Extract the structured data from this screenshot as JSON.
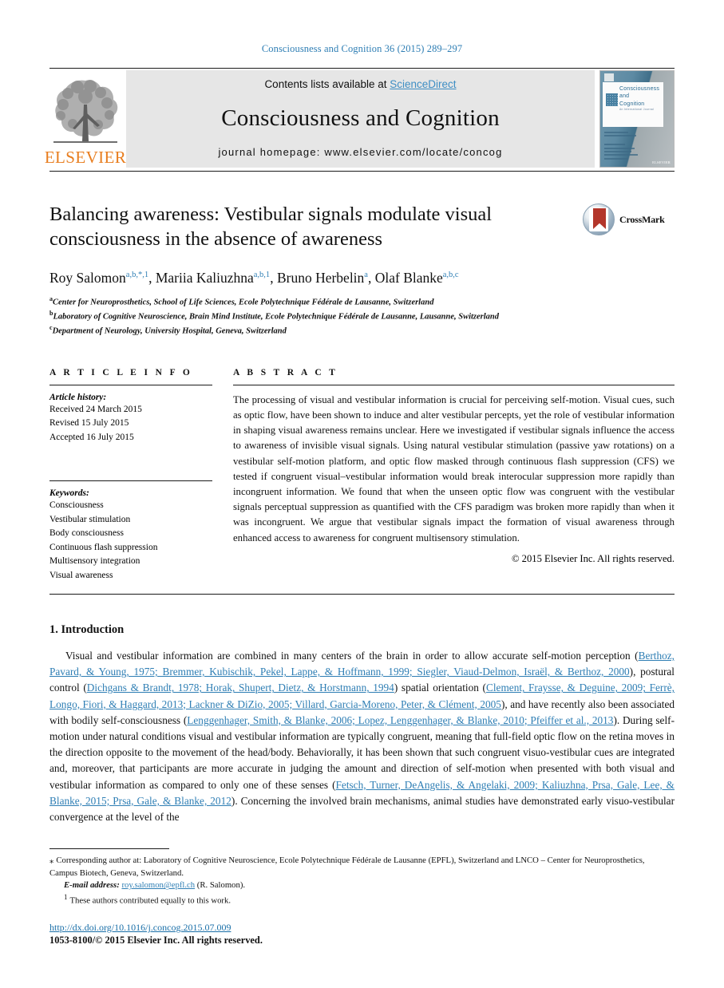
{
  "running_head": "Consciousness and Cognition 36 (2015) 289–297",
  "masthead": {
    "contents_prefix": "Contents lists available at ",
    "sciencedirect": "ScienceDirect",
    "journal_name": "Consciousness and Cognition",
    "homepage": "journal homepage: www.elsevier.com/locate/concog",
    "publisher": "ELSEVIER",
    "cover": {
      "title_line1": "Consciousness",
      "title_line2": "and",
      "title_line3": "Cognition",
      "subtitle": "An International Journal",
      "publisher_mark": "ELSEVIER"
    },
    "colors": {
      "link_blue": "#3e8ec4",
      "elsevier_orange": "#e87d1e",
      "panel_grey": "#e6e6e6"
    }
  },
  "article": {
    "title": "Balancing awareness: Vestibular signals modulate visual consciousness in the absence of awareness",
    "crossmark_label": "CrossMark",
    "authors": [
      {
        "name": "Roy Salomon",
        "sup": "a,b,*,1"
      },
      {
        "name": "Mariia Kaliuzhna",
        "sup": "a,b,1"
      },
      {
        "name": "Bruno Herbelin",
        "sup": "a"
      },
      {
        "name": "Olaf Blanke",
        "sup": "a,b,c"
      }
    ],
    "affiliations": [
      {
        "marker": "a",
        "text": "Center for Neuroprosthetics, School of Life Sciences, Ecole Polytechnique Fédérale de Lausanne, Switzerland"
      },
      {
        "marker": "b",
        "text": "Laboratory of Cognitive Neuroscience, Brain Mind Institute, Ecole Polytechnique Fédérale de Lausanne, Lausanne, Switzerland"
      },
      {
        "marker": "c",
        "text": "Department of Neurology, University Hospital, Geneva, Switzerland"
      }
    ]
  },
  "article_info": {
    "heading": "A R T I C L E   I N F O",
    "history_label": "Article history:",
    "history": [
      "Received 24 March 2015",
      "Revised 15 July 2015",
      "Accepted 16 July 2015"
    ],
    "keywords_label": "Keywords:",
    "keywords": [
      "Consciousness",
      "Vestibular stimulation",
      "Body consciousness",
      "Continuous flash suppression",
      "Multisensory integration",
      "Visual awareness"
    ]
  },
  "abstract": {
    "heading": "A B S T R A C T",
    "text": "The processing of visual and vestibular information is crucial for perceiving self-motion. Visual cues, such as optic flow, have been shown to induce and alter vestibular percepts, yet the role of vestibular information in shaping visual awareness remains unclear. Here we investigated if vestibular signals influence the access to awareness of invisible visual signals. Using natural vestibular stimulation (passive yaw rotations) on a vestibular self-motion platform, and optic flow masked through continuous flash suppression (CFS) we tested if congruent visual–vestibular information would break interocular suppression more rapidly than incongruent information. We found that when the unseen optic flow was congruent with the vestibular signals perceptual suppression as quantified with the CFS paradigm was broken more rapidly than when it was incongruent. We argue that vestibular signals impact the formation of visual awareness through enhanced access to awareness for congruent multisensory stimulation.",
    "copyright": "© 2015 Elsevier Inc. All rights reserved."
  },
  "introduction": {
    "heading": "1. Introduction",
    "paragraph_parts": [
      {
        "type": "text",
        "value": "Visual and vestibular information are combined in many centers of the brain in order to allow accurate self-motion perception ("
      },
      {
        "type": "ref",
        "value": "Berthoz, Pavard, & Young, 1975; Bremmer, Kubischik, Pekel, Lappe, & Hoffmann, 1999; Siegler, Viaud-Delmon, Israël, & Berthoz, 2000"
      },
      {
        "type": "text",
        "value": "), postural control ("
      },
      {
        "type": "ref",
        "value": "Dichgans & Brandt, 1978; Horak, Shupert, Dietz, & Horstmann, 1994"
      },
      {
        "type": "text",
        "value": ") spatial orientation ("
      },
      {
        "type": "ref",
        "value": "Clement, Fraysse, & Deguine, 2009; Ferrè, Longo, Fiori, & Haggard, 2013; Lackner & DiZio, 2005; Villard, Garcia-Moreno, Peter, & Clément, 2005"
      },
      {
        "type": "text",
        "value": "), and have recently also been associated with bodily self-consciousness ("
      },
      {
        "type": "ref",
        "value": "Lenggenhager, Smith, & Blanke, 2006; Lopez, Lenggenhager, & Blanke, 2010; Pfeiffer et al., 2013"
      },
      {
        "type": "text",
        "value": "). During self-motion under natural conditions visual and vestibular information are typically congruent, meaning that full-field optic flow on the retina moves in the direction opposite to the movement of the head/body. Behaviorally, it has been shown that such congruent visuo-vestibular cues are integrated and, moreover, that participants are more accurate in judging the amount and direction of self-motion when presented with both visual and vestibular information as compared to only one of these senses ("
      },
      {
        "type": "ref",
        "value": "Fetsch, Turner, DeAngelis, & Angelaki, 2009; Kaliuzhna, Prsa, Gale, Lee, & Blanke, 2015; Prsa, Gale, & Blanke, 2012"
      },
      {
        "type": "text",
        "value": "). Concerning the involved brain mechanisms, animal studies have demonstrated early visuo-vestibular convergence at the level of the"
      }
    ]
  },
  "footnotes": {
    "corresponding_marker": "⁎",
    "corresponding": "Corresponding author at: Laboratory of Cognitive Neuroscience, Ecole Polytechnique Fédérale de Lausanne (EPFL), Switzerland and LNCO – Center for Neuroprosthetics, Campus Biotech, Geneva, Switzerland.",
    "email_label": "E-mail address:",
    "email": "roy.salomon@epfl.ch",
    "email_suffix": "(R. Salomon).",
    "equal_marker": "1",
    "equal_contribution": "These authors contributed equally to this work.",
    "doi": "http://dx.doi.org/10.1016/j.concog.2015.07.009",
    "issn_line": "1053-8100/© 2015 Elsevier Inc. All rights reserved."
  }
}
